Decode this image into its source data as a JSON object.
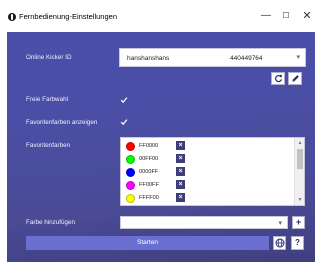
{
  "window": {
    "title": "Fernbedienung-Einstellungen",
    "minimize": "—",
    "maximize": "☐",
    "close": "✕"
  },
  "kicker": {
    "label": "Online Kicker ID",
    "name": "hanshanshans",
    "id": "440449764",
    "dropdown_icon": "chevron-down-icon",
    "sync_icon": "sync-icon",
    "edit_icon": "pencil-icon"
  },
  "options": {
    "free_color_label": "Freie Farbwahl",
    "free_color_checked": true,
    "show_favorites_label": "Favoritenfarben anzeigen",
    "show_favorites_checked": true
  },
  "favorites": {
    "label": "Favoritenfarben",
    "items": [
      {
        "hex": "FF0000",
        "color": "#ff0000"
      },
      {
        "hex": "00FF00",
        "color": "#00ff00"
      },
      {
        "hex": "0000FF",
        "color": "#0000ff"
      },
      {
        "hex": "FF00FF",
        "color": "#ff00ff"
      },
      {
        "hex": "FFFF00",
        "color": "#ffff00"
      }
    ],
    "remove_icon": "remove-x-icon"
  },
  "add_color": {
    "label": "Farbe hinzufügen",
    "value": "",
    "add_symbol": "+"
  },
  "footer": {
    "start_label": "Starten",
    "globe_icon": "globe-icon",
    "help_label": "?"
  },
  "colors": {
    "panel": "#4b4ea5",
    "start_button": "#6a6ed0"
  }
}
